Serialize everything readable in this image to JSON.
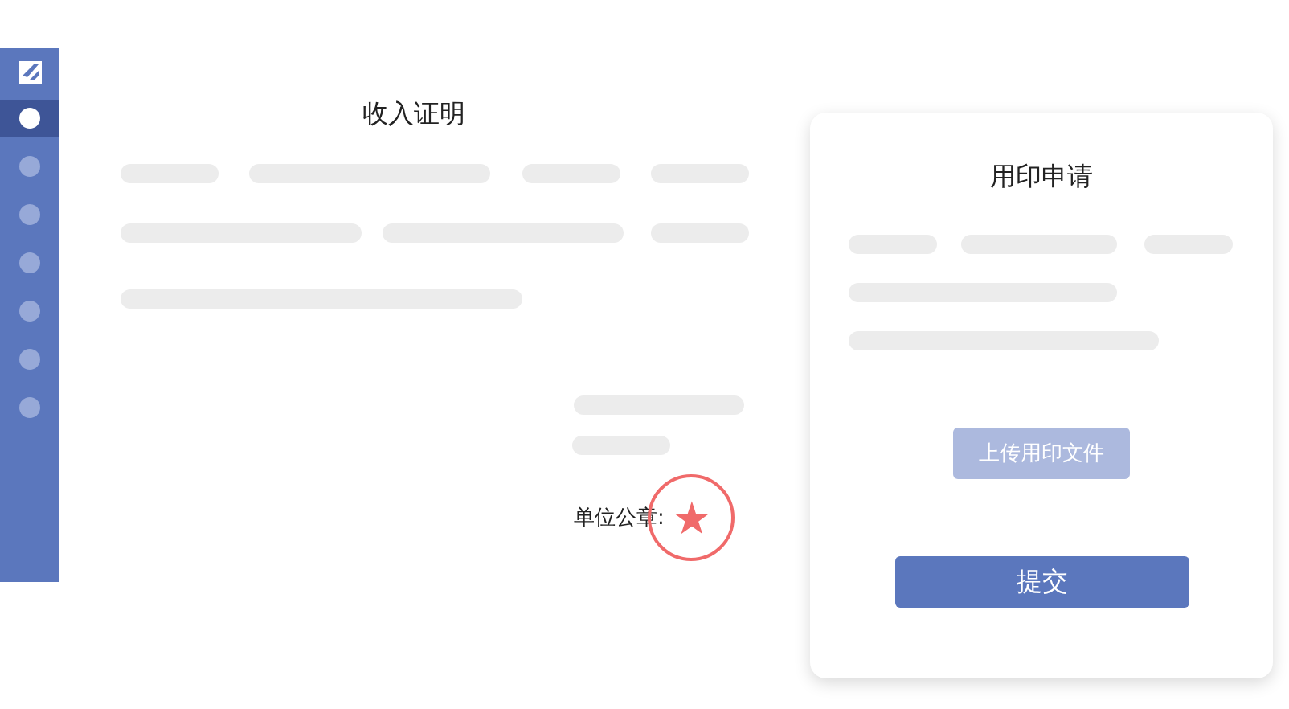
{
  "sidebar": {
    "items": [
      {
        "selected": true
      },
      {
        "selected": false
      },
      {
        "selected": false
      },
      {
        "selected": false
      },
      {
        "selected": false
      },
      {
        "selected": false
      },
      {
        "selected": false
      }
    ]
  },
  "document": {
    "title": "收入证明",
    "stamp_label": "单位公章:",
    "stamp": "★"
  },
  "card": {
    "title": "用印申请",
    "upload_button": {
      "label": "上传用印文件",
      "disabled": true
    },
    "submit_button": {
      "label": "提交"
    }
  }
}
